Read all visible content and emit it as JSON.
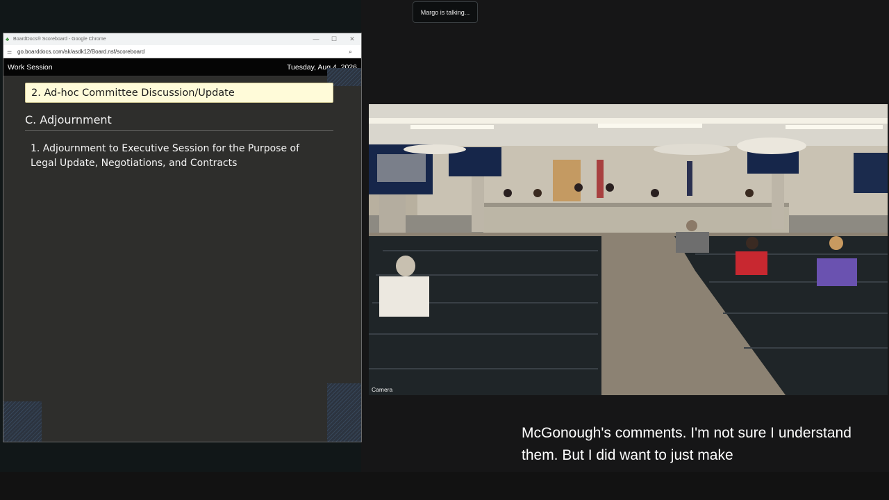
{
  "meeting": {
    "talking_indicator": "Margo is talking..."
  },
  "browser": {
    "window_title": "BoardDocs® Scoreboard - Google Chrome",
    "url": "go.boarddocs.com/ak/asdk12/Board.nsf/scoreboard",
    "favicon": "tree-icon",
    "controls": [
      "—",
      "☐",
      "✕"
    ]
  },
  "boarddocs": {
    "header_left": "Work Session",
    "header_right": "Tuesday, Aug 4, 2026",
    "active_item": "2. Ad-hoc Committee Discussion/Update",
    "section_title": "C. Adjournment",
    "section_item": "1. Adjournment to Executive Session for the Purpose of Legal Update, Negotiations, and Contracts"
  },
  "camera": {
    "label": "Camera"
  },
  "caption": {
    "text": "McGonough's comments. I'm not sure I understand them. But I did want to just make"
  }
}
